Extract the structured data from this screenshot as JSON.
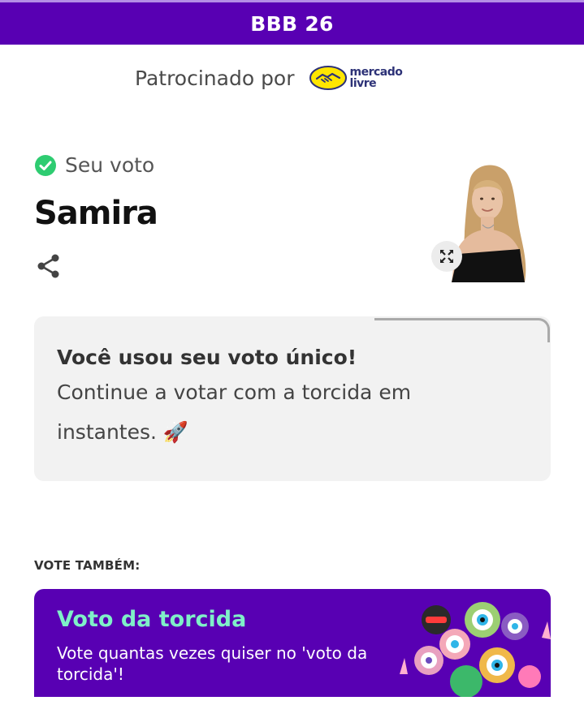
{
  "header": {
    "title": "BBB 26"
  },
  "sponsor": {
    "label": "Patrocinado por",
    "logo_text_line1": "mercado",
    "logo_text_line2": "livre",
    "logo_colors": {
      "yellow": "#ffe600",
      "navy": "#2d3277"
    }
  },
  "vote": {
    "status_label": "Seu voto",
    "candidate_name": "Samira",
    "share_icon": "share-icon",
    "expand_icon": "expand-icon"
  },
  "notice": {
    "title": "Você usou seu voto único!",
    "body_line1": "Continue a votar com a torcida em",
    "body_line2": "instantes. 🚀"
  },
  "also_vote": {
    "section_label": "VOTE TAMBÉM:",
    "card": {
      "title": "Voto da torcida",
      "description": "Vote quantas vezes quiser no 'voto da torcida'!"
    }
  },
  "colors": {
    "brand_purple": "#5800b3",
    "accent_mint": "#7ff0c8",
    "check_green": "#2ecc71",
    "card_gray": "#f2f2f2"
  }
}
